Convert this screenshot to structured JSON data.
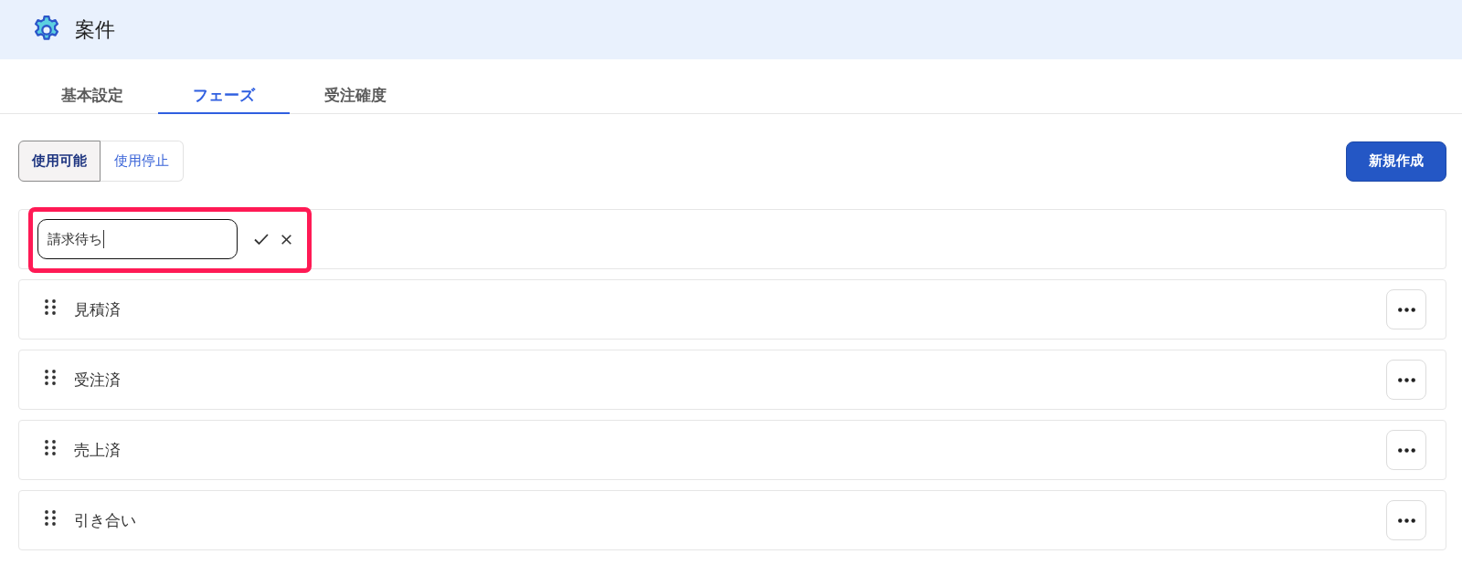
{
  "header": {
    "title": "案件"
  },
  "tabs": [
    {
      "label": "基本設定",
      "selected": false
    },
    {
      "label": "フェーズ",
      "selected": true
    },
    {
      "label": "受注確度",
      "selected": false
    }
  ],
  "filter": [
    {
      "label": "使用可能",
      "selected": true
    },
    {
      "label": "使用停止",
      "selected": false
    }
  ],
  "new_button": {
    "label": "新規作成"
  },
  "editing_row": {
    "value": "請求待ち",
    "highlighted": true
  },
  "phases": [
    {
      "name": "見積済"
    },
    {
      "name": "受注済"
    },
    {
      "name": "売上済"
    },
    {
      "name": "引き合い"
    }
  ]
}
